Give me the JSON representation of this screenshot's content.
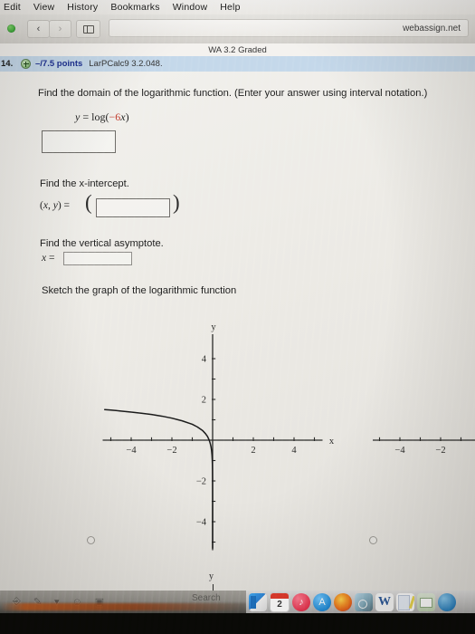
{
  "menubar": {
    "items": [
      {
        "label": "Edit"
      },
      {
        "label": "View"
      },
      {
        "label": "History"
      },
      {
        "label": "Bookmarks"
      },
      {
        "label": "Window"
      },
      {
        "label": "Help"
      }
    ]
  },
  "browser": {
    "back_glyph": "‹",
    "forward_glyph": "›",
    "url": "webassign.net"
  },
  "assignment": {
    "title": "WA 3.2 Graded",
    "question_number": "14.",
    "points": "–/7.5 points",
    "reference": "LarPCalc9 3.2.048."
  },
  "question": {
    "domain_prompt": "Find the domain of the logarithmic function. (Enter your answer using interval notation.)",
    "equation_y": "y",
    "equation_eq": "=",
    "equation_fn": "log(",
    "equation_sign": "−",
    "equation_coef": "6",
    "equation_var": "x",
    "equation_close": ")",
    "domain_answer": "",
    "domain_placeholder": "",
    "xintercept_prompt": "Find the x-intercept.",
    "xintercept_label_open": "(",
    "xintercept_label_x": "x",
    "xintercept_label_comma": ", ",
    "xintercept_label_y": "y",
    "xintercept_label_close": ") =",
    "xintercept_answer": "",
    "paren_left": "(",
    "paren_right": ")",
    "asymptote_prompt": "Find the vertical asymptote.",
    "asymptote_label_x": "x",
    "asymptote_label_eq": " =",
    "asymptote_answer": "",
    "sketch_prompt": "Sketch the graph of the logarithmic function"
  },
  "chart_data": {
    "type": "line",
    "title": "",
    "xlabel": "x",
    "ylabel": "y",
    "xlim": [
      -5.4,
      5.4
    ],
    "ylim": [
      -5.4,
      5.2
    ],
    "xticks": [
      -5,
      -4,
      -3,
      -2,
      -1,
      1,
      2,
      3,
      4,
      5
    ],
    "yticks": [
      -5,
      -4,
      -3,
      -2,
      -1,
      1,
      2,
      3,
      4
    ],
    "xtick_labels": [
      {
        "value": -4,
        "label": "−4"
      },
      {
        "value": -2,
        "label": "−2"
      },
      {
        "value": 2,
        "label": "2"
      },
      {
        "value": 4,
        "label": "4"
      }
    ],
    "ytick_labels": [
      {
        "value": 4,
        "label": "4"
      },
      {
        "value": 2,
        "label": "2"
      },
      {
        "value": -2,
        "label": "−2"
      },
      {
        "value": -4,
        "label": "−4"
      }
    ],
    "grid": false,
    "legend": null,
    "series": [
      {
        "name": "y = log(-6x)",
        "color": "#1a1a1a",
        "points": [
          {
            "x": -5.3,
            "y": 1.5
          },
          {
            "x": -5.0,
            "y": 1.48
          },
          {
            "x": -4.5,
            "y": 1.43
          },
          {
            "x": -4.0,
            "y": 1.38
          },
          {
            "x": -3.5,
            "y": 1.32
          },
          {
            "x": -3.0,
            "y": 1.26
          },
          {
            "x": -2.5,
            "y": 1.18
          },
          {
            "x": -2.0,
            "y": 1.08
          },
          {
            "x": -1.5,
            "y": 0.95
          },
          {
            "x": -1.0,
            "y": 0.78
          },
          {
            "x": -0.75,
            "y": 0.65
          },
          {
            "x": -0.5,
            "y": 0.48
          },
          {
            "x": -0.35,
            "y": 0.32
          },
          {
            "x": -0.25,
            "y": 0.18
          },
          {
            "x": -0.1667,
            "y": 0.0
          },
          {
            "x": -0.12,
            "y": -0.15
          },
          {
            "x": -0.08,
            "y": -0.32
          },
          {
            "x": -0.05,
            "y": -0.52
          },
          {
            "x": -0.03,
            "y": -0.74
          },
          {
            "x": -0.018,
            "y": -0.97
          },
          {
            "x": -0.01,
            "y": -1.22
          },
          {
            "x": -0.005,
            "y": -1.52
          },
          {
            "x": -0.002,
            "y": -1.92
          },
          {
            "x": -0.0008,
            "y": -2.32
          },
          {
            "x": -0.0002,
            "y": -2.92
          },
          {
            "x": -5e-05,
            "y": -3.52
          },
          {
            "x": -1e-05,
            "y": -4.22
          },
          {
            "x": -2e-06,
            "y": -4.92
          },
          {
            "x": -5e-07,
            "y": -5.3
          }
        ]
      }
    ],
    "asymptote": {
      "type": "vertical",
      "x": 0
    },
    "second_panel": {
      "xtick_labels": [
        {
          "value": -4,
          "label": "−4"
        },
        {
          "value": -2,
          "label": "−2"
        }
      ],
      "ylabel": "y",
      "note": "partially visible duplicate axis, cropped at right edge"
    }
  },
  "graph_options": {
    "option_1_selected": false,
    "option_2_selected": false
  },
  "dock": {
    "items": [
      {
        "name": "finder"
      },
      {
        "name": "calendar",
        "badge": "2"
      },
      {
        "name": "itunes"
      },
      {
        "name": "app-store"
      },
      {
        "name": "firefox"
      },
      {
        "name": "preview"
      },
      {
        "name": "word",
        "glyph": "W"
      },
      {
        "name": "notes"
      },
      {
        "name": "mail"
      },
      {
        "name": "safari"
      }
    ]
  },
  "bottom_toolbar": {
    "search_placeholder": "Search",
    "icons": [
      "power-icon",
      "pen-icon",
      "chevron-down-icon",
      "person-icon",
      "camera-icon"
    ]
  }
}
